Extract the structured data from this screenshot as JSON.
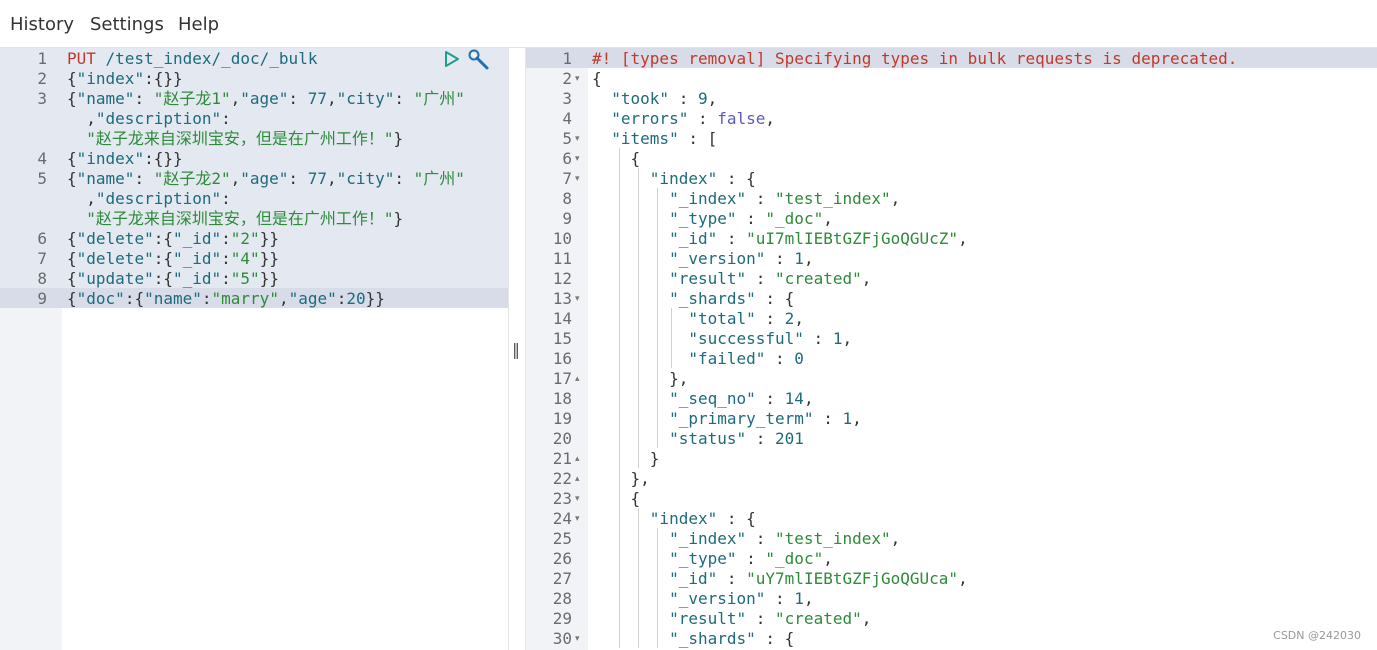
{
  "menu": {
    "history": "History",
    "settings": "Settings",
    "help": "Help"
  },
  "request": {
    "lines": [
      {
        "n": "1",
        "parts": [
          [
            "PUT ",
            "t-method"
          ],
          [
            "/test_index/_doc/_bulk",
            "t-url"
          ]
        ]
      },
      {
        "n": "2",
        "parts": [
          [
            "{",
            "t-punc"
          ],
          [
            "\"index\"",
            "t-key"
          ],
          [
            ":{}}",
            "t-punc"
          ]
        ]
      },
      {
        "n": "3",
        "parts": [
          [
            "{",
            "t-punc"
          ],
          [
            "\"name\"",
            "t-key"
          ],
          [
            ": ",
            "t-punc"
          ],
          [
            "\"赵子龙1\"",
            "t-str"
          ],
          [
            ",",
            "t-punc"
          ],
          [
            "\"age\"",
            "t-key"
          ],
          [
            ": ",
            "t-punc"
          ],
          [
            "77",
            "t-num"
          ],
          [
            ",",
            "t-punc"
          ],
          [
            "\"city\"",
            "t-key"
          ],
          [
            ": ",
            "t-punc"
          ],
          [
            "\"广州\"",
            "t-str"
          ]
        ]
      },
      {
        "n": "",
        "parts": [
          [
            "  ,",
            "t-punc"
          ],
          [
            "\"description\"",
            "t-key"
          ],
          [
            ":",
            "t-punc"
          ]
        ]
      },
      {
        "n": "",
        "parts": [
          [
            "  ",
            "t-punc"
          ],
          [
            "\"赵子龙来自深圳宝安，但是在广州工作！\"",
            "t-str"
          ],
          [
            "}",
            "t-punc"
          ]
        ]
      },
      {
        "n": "4",
        "parts": [
          [
            "{",
            "t-punc"
          ],
          [
            "\"index\"",
            "t-key"
          ],
          [
            ":{}}",
            "t-punc"
          ]
        ]
      },
      {
        "n": "5",
        "parts": [
          [
            "{",
            "t-punc"
          ],
          [
            "\"name\"",
            "t-key"
          ],
          [
            ": ",
            "t-punc"
          ],
          [
            "\"赵子龙2\"",
            "t-str"
          ],
          [
            ",",
            "t-punc"
          ],
          [
            "\"age\"",
            "t-key"
          ],
          [
            ": ",
            "t-punc"
          ],
          [
            "77",
            "t-num"
          ],
          [
            ",",
            "t-punc"
          ],
          [
            "\"city\"",
            "t-key"
          ],
          [
            ": ",
            "t-punc"
          ],
          [
            "\"广州\"",
            "t-str"
          ]
        ]
      },
      {
        "n": "",
        "parts": [
          [
            "  ,",
            "t-punc"
          ],
          [
            "\"description\"",
            "t-key"
          ],
          [
            ":",
            "t-punc"
          ]
        ]
      },
      {
        "n": "",
        "parts": [
          [
            "  ",
            "t-punc"
          ],
          [
            "\"赵子龙来自深圳宝安，但是在广州工作！\"",
            "t-str"
          ],
          [
            "}",
            "t-punc"
          ]
        ]
      },
      {
        "n": "6",
        "parts": [
          [
            "{",
            "t-punc"
          ],
          [
            "\"delete\"",
            "t-key"
          ],
          [
            ":{",
            "t-punc"
          ],
          [
            "\"_id\"",
            "t-key"
          ],
          [
            ":",
            "t-punc"
          ],
          [
            "\"2\"",
            "t-str"
          ],
          [
            "}}",
            "t-punc"
          ]
        ]
      },
      {
        "n": "7",
        "parts": [
          [
            "{",
            "t-punc"
          ],
          [
            "\"delete\"",
            "t-key"
          ],
          [
            ":{",
            "t-punc"
          ],
          [
            "\"_id\"",
            "t-key"
          ],
          [
            ":",
            "t-punc"
          ],
          [
            "\"4\"",
            "t-str"
          ],
          [
            "}}",
            "t-punc"
          ]
        ]
      },
      {
        "n": "8",
        "parts": [
          [
            "{",
            "t-punc"
          ],
          [
            "\"update\"",
            "t-key"
          ],
          [
            ":{",
            "t-punc"
          ],
          [
            "\"_id\"",
            "t-key"
          ],
          [
            ":",
            "t-punc"
          ],
          [
            "\"5\"",
            "t-str"
          ],
          [
            "}}",
            "t-punc"
          ]
        ]
      },
      {
        "n": "9",
        "parts": [
          [
            "{",
            "t-punc"
          ],
          [
            "\"doc\"",
            "t-key"
          ],
          [
            ":{",
            "t-punc"
          ],
          [
            "\"name\"",
            "t-key"
          ],
          [
            ":",
            "t-punc"
          ],
          [
            "\"marry\"",
            "t-str"
          ],
          [
            ",",
            "t-punc"
          ],
          [
            "\"age\"",
            "t-key"
          ],
          [
            ":",
            "t-punc"
          ],
          [
            "20",
            "t-num"
          ],
          [
            "}}",
            "t-punc"
          ]
        ]
      }
    ]
  },
  "response": {
    "lines": [
      {
        "n": "1",
        "fold": "",
        "parts": [
          [
            "#! [types removal] Specifying types in bulk requests is deprecated.",
            "t-comment"
          ]
        ]
      },
      {
        "n": "2",
        "fold": "▾",
        "parts": [
          [
            "{",
            "t-punc"
          ]
        ]
      },
      {
        "n": "3",
        "fold": "",
        "parts": [
          [
            "  ",
            "t-punc"
          ],
          [
            "\"took\"",
            "t-key"
          ],
          [
            " : ",
            "t-punc"
          ],
          [
            "9",
            "t-num"
          ],
          [
            ",",
            "t-punc"
          ]
        ]
      },
      {
        "n": "4",
        "fold": "",
        "parts": [
          [
            "  ",
            "t-punc"
          ],
          [
            "\"errors\"",
            "t-key"
          ],
          [
            " : ",
            "t-punc"
          ],
          [
            "false",
            "t-bool"
          ],
          [
            ",",
            "t-punc"
          ]
        ]
      },
      {
        "n": "5",
        "fold": "▾",
        "parts": [
          [
            "  ",
            "t-punc"
          ],
          [
            "\"items\"",
            "t-key"
          ],
          [
            " : [",
            "t-punc"
          ]
        ]
      },
      {
        "n": "6",
        "fold": "▾",
        "parts": [
          [
            "    {",
            "t-punc"
          ]
        ]
      },
      {
        "n": "7",
        "fold": "▾",
        "parts": [
          [
            "      ",
            "t-punc"
          ],
          [
            "\"index\"",
            "t-key"
          ],
          [
            " : {",
            "t-punc"
          ]
        ]
      },
      {
        "n": "8",
        "fold": "",
        "parts": [
          [
            "        ",
            "t-punc"
          ],
          [
            "\"_index\"",
            "t-key"
          ],
          [
            " : ",
            "t-punc"
          ],
          [
            "\"test_index\"",
            "t-str"
          ],
          [
            ",",
            "t-punc"
          ]
        ]
      },
      {
        "n": "9",
        "fold": "",
        "parts": [
          [
            "        ",
            "t-punc"
          ],
          [
            "\"_type\"",
            "t-key"
          ],
          [
            " : ",
            "t-punc"
          ],
          [
            "\"_doc\"",
            "t-str"
          ],
          [
            ",",
            "t-punc"
          ]
        ]
      },
      {
        "n": "10",
        "fold": "",
        "parts": [
          [
            "        ",
            "t-punc"
          ],
          [
            "\"_id\"",
            "t-key"
          ],
          [
            " : ",
            "t-punc"
          ],
          [
            "\"uI7mlIEBtGZFjGoQGUcZ\"",
            "t-str"
          ],
          [
            ",",
            "t-punc"
          ]
        ]
      },
      {
        "n": "11",
        "fold": "",
        "parts": [
          [
            "        ",
            "t-punc"
          ],
          [
            "\"_version\"",
            "t-key"
          ],
          [
            " : ",
            "t-punc"
          ],
          [
            "1",
            "t-num"
          ],
          [
            ",",
            "t-punc"
          ]
        ]
      },
      {
        "n": "12",
        "fold": "",
        "parts": [
          [
            "        ",
            "t-punc"
          ],
          [
            "\"result\"",
            "t-key"
          ],
          [
            " : ",
            "t-punc"
          ],
          [
            "\"created\"",
            "t-str"
          ],
          [
            ",",
            "t-punc"
          ]
        ]
      },
      {
        "n": "13",
        "fold": "▾",
        "parts": [
          [
            "        ",
            "t-punc"
          ],
          [
            "\"_shards\"",
            "t-key"
          ],
          [
            " : {",
            "t-punc"
          ]
        ]
      },
      {
        "n": "14",
        "fold": "",
        "parts": [
          [
            "          ",
            "t-punc"
          ],
          [
            "\"total\"",
            "t-key"
          ],
          [
            " : ",
            "t-punc"
          ],
          [
            "2",
            "t-num"
          ],
          [
            ",",
            "t-punc"
          ]
        ]
      },
      {
        "n": "15",
        "fold": "",
        "parts": [
          [
            "          ",
            "t-punc"
          ],
          [
            "\"successful\"",
            "t-key"
          ],
          [
            " : ",
            "t-punc"
          ],
          [
            "1",
            "t-num"
          ],
          [
            ",",
            "t-punc"
          ]
        ]
      },
      {
        "n": "16",
        "fold": "",
        "parts": [
          [
            "          ",
            "t-punc"
          ],
          [
            "\"failed\"",
            "t-key"
          ],
          [
            " : ",
            "t-punc"
          ],
          [
            "0",
            "t-num"
          ]
        ]
      },
      {
        "n": "17",
        "fold": "▴",
        "parts": [
          [
            "        },",
            "t-punc"
          ]
        ]
      },
      {
        "n": "18",
        "fold": "",
        "parts": [
          [
            "        ",
            "t-punc"
          ],
          [
            "\"_seq_no\"",
            "t-key"
          ],
          [
            " : ",
            "t-punc"
          ],
          [
            "14",
            "t-num"
          ],
          [
            ",",
            "t-punc"
          ]
        ]
      },
      {
        "n": "19",
        "fold": "",
        "parts": [
          [
            "        ",
            "t-punc"
          ],
          [
            "\"_primary_term\"",
            "t-key"
          ],
          [
            " : ",
            "t-punc"
          ],
          [
            "1",
            "t-num"
          ],
          [
            ",",
            "t-punc"
          ]
        ]
      },
      {
        "n": "20",
        "fold": "",
        "parts": [
          [
            "        ",
            "t-punc"
          ],
          [
            "\"status\"",
            "t-key"
          ],
          [
            " : ",
            "t-punc"
          ],
          [
            "201",
            "t-num"
          ]
        ]
      },
      {
        "n": "21",
        "fold": "▴",
        "parts": [
          [
            "      }",
            "t-punc"
          ]
        ]
      },
      {
        "n": "22",
        "fold": "▴",
        "parts": [
          [
            "    },",
            "t-punc"
          ]
        ]
      },
      {
        "n": "23",
        "fold": "▾",
        "parts": [
          [
            "    {",
            "t-punc"
          ]
        ]
      },
      {
        "n": "24",
        "fold": "▾",
        "parts": [
          [
            "      ",
            "t-punc"
          ],
          [
            "\"index\"",
            "t-key"
          ],
          [
            " : {",
            "t-punc"
          ]
        ]
      },
      {
        "n": "25",
        "fold": "",
        "parts": [
          [
            "        ",
            "t-punc"
          ],
          [
            "\"_index\"",
            "t-key"
          ],
          [
            " : ",
            "t-punc"
          ],
          [
            "\"test_index\"",
            "t-str"
          ],
          [
            ",",
            "t-punc"
          ]
        ]
      },
      {
        "n": "26",
        "fold": "",
        "parts": [
          [
            "        ",
            "t-punc"
          ],
          [
            "\"_type\"",
            "t-key"
          ],
          [
            " : ",
            "t-punc"
          ],
          [
            "\"_doc\"",
            "t-str"
          ],
          [
            ",",
            "t-punc"
          ]
        ]
      },
      {
        "n": "27",
        "fold": "",
        "parts": [
          [
            "        ",
            "t-punc"
          ],
          [
            "\"_id\"",
            "t-key"
          ],
          [
            " : ",
            "t-punc"
          ],
          [
            "\"uY7mlIEBtGZFjGoQGUca\"",
            "t-str"
          ],
          [
            ",",
            "t-punc"
          ]
        ]
      },
      {
        "n": "28",
        "fold": "",
        "parts": [
          [
            "        ",
            "t-punc"
          ],
          [
            "\"_version\"",
            "t-key"
          ],
          [
            " : ",
            "t-punc"
          ],
          [
            "1",
            "t-num"
          ],
          [
            ",",
            "t-punc"
          ]
        ]
      },
      {
        "n": "29",
        "fold": "",
        "parts": [
          [
            "        ",
            "t-punc"
          ],
          [
            "\"result\"",
            "t-key"
          ],
          [
            " : ",
            "t-punc"
          ],
          [
            "\"created\"",
            "t-str"
          ],
          [
            ",",
            "t-punc"
          ]
        ]
      },
      {
        "n": "30",
        "fold": "▾",
        "parts": [
          [
            "        ",
            "t-punc"
          ],
          [
            "\"_shards\"",
            "t-key"
          ],
          [
            " : {",
            "t-punc"
          ]
        ]
      }
    ]
  },
  "icons": {
    "run": "play-icon",
    "wrench": "wrench-icon"
  },
  "watermark": "CSDN @242030"
}
